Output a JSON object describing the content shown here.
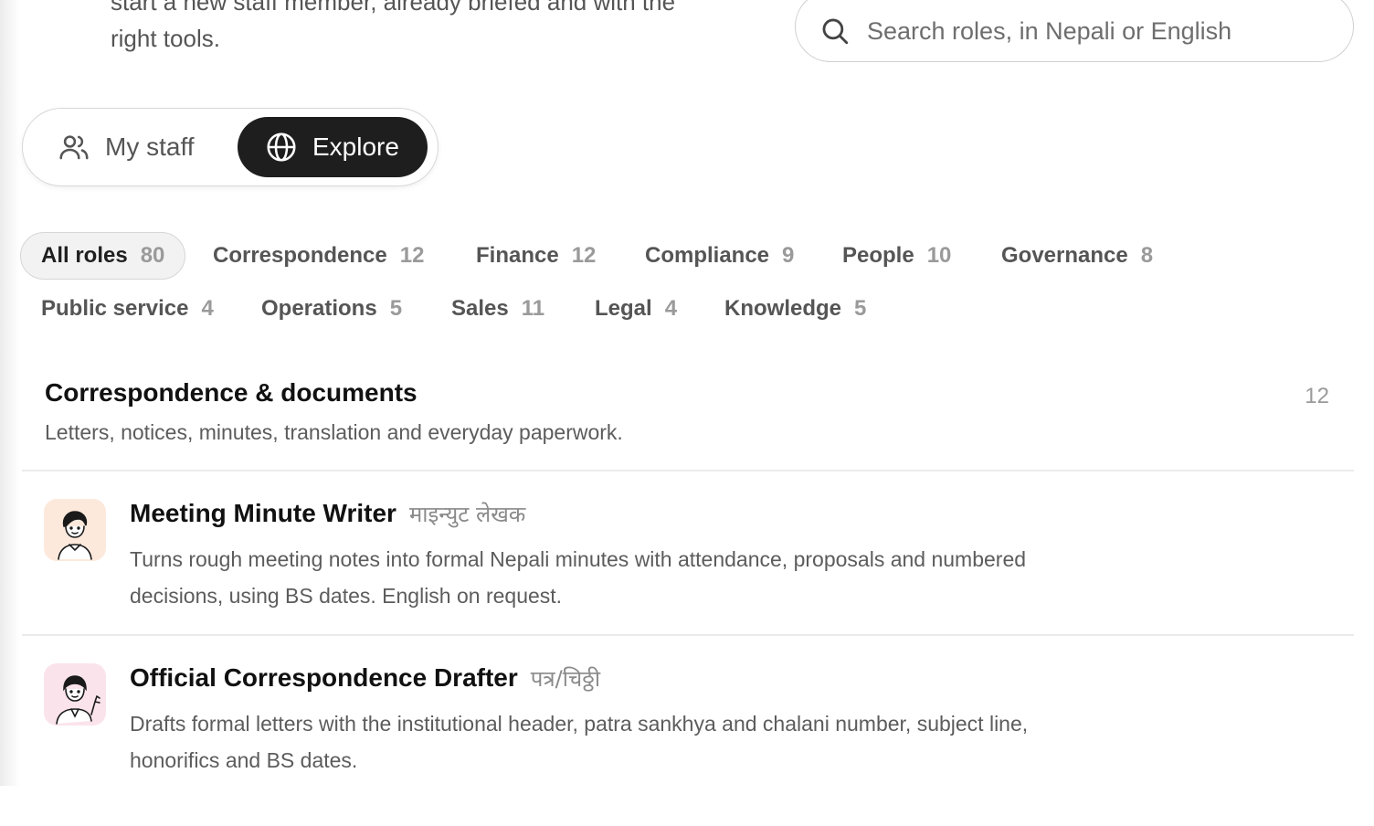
{
  "intro": {
    "line1": "start a new staff member, already briefed and with the",
    "line2": "right tools."
  },
  "search": {
    "placeholder": "Search roles, in Nepali or English"
  },
  "toggle": {
    "my_staff": "My staff",
    "explore": "Explore",
    "active": "explore"
  },
  "filters": [
    {
      "label": "All roles",
      "count": "80",
      "active": true
    },
    {
      "label": "Correspondence",
      "count": "12"
    },
    {
      "label": "Finance",
      "count": "12"
    },
    {
      "label": "Compliance",
      "count": "9"
    },
    {
      "label": "People",
      "count": "10"
    },
    {
      "label": "Governance",
      "count": "8"
    },
    {
      "label": "Public service",
      "count": "4"
    },
    {
      "label": "Operations",
      "count": "5"
    },
    {
      "label": "Sales",
      "count": "11"
    },
    {
      "label": "Legal",
      "count": "4"
    },
    {
      "label": "Knowledge",
      "count": "5"
    }
  ],
  "section": {
    "title": "Correspondence & documents",
    "count": "12",
    "description": "Letters, notices, minutes, translation and everyday paperwork."
  },
  "roles": [
    {
      "title": "Meeting Minute Writer",
      "native": "माइन्युट लेखक",
      "description": "Turns rough meeting notes into formal Nepali minutes with attendance, proposals and numbered decisions, using BS dates. English on request.",
      "avatar_bg": "#fde9dc",
      "avatar_icon": "person-illustration-icon"
    },
    {
      "title": "Official Correspondence Drafter",
      "native": "पत्र/चिठ्ठी",
      "description": "Drafts formal letters with the institutional header, patra sankhya and chalani number, subject line, honorifics and BS dates.",
      "avatar_bg": "#fbe3ec",
      "avatar_icon": "person-waving-illustration-icon"
    }
  ],
  "colors": {
    "accent_dark": "#1e1e1e",
    "muted": "#9a9a9a"
  }
}
